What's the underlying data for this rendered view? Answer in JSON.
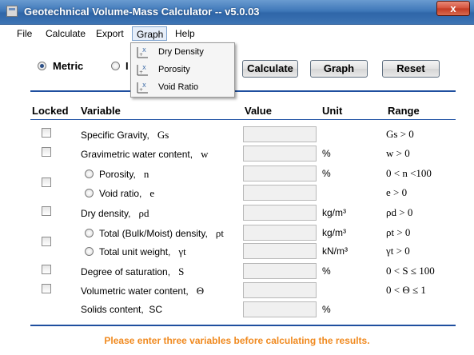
{
  "window": {
    "title": "Geotechnical Volume-Mass Calculator -- v5.0.03",
    "close_label": "x"
  },
  "menu": [
    "File",
    "Calculate",
    "Export",
    "Graph",
    "Help"
  ],
  "graph_menu": [
    {
      "label": "Dry Density",
      "icon": "xy-graph-icon"
    },
    {
      "label": "Porosity",
      "icon": "xy-graph-icon"
    },
    {
      "label": "Void Ratio",
      "icon": "xy-graph-icon"
    }
  ],
  "units": {
    "metric_label": "Metric",
    "imperial_label": "I",
    "selected": "Metric"
  },
  "buttons": {
    "calculate": "Calculate",
    "graph": "Graph",
    "reset": "Reset"
  },
  "headers": {
    "locked": "Locked",
    "variable": "Variable",
    "value": "Value",
    "unit": "Unit",
    "range": "Range"
  },
  "rows": [
    {
      "label": "Specific Gravity,",
      "symbol": "Gs",
      "unit": "",
      "range": "Gs > 0"
    },
    {
      "label": "Gravimetric water content,",
      "symbol": "w",
      "unit": "%",
      "range": "w > 0"
    },
    {
      "label": "Porosity,",
      "symbol": "n",
      "unit": "%",
      "range": "0 < n <100"
    },
    {
      "label": "Void ratio,",
      "symbol": "e",
      "unit": "",
      "range": "e > 0"
    },
    {
      "label": "Dry density,",
      "symbol": "ρd",
      "unit": "kg/m³",
      "range": "ρd > 0"
    },
    {
      "label": "Total (Bulk/Moist) density,",
      "symbol": "ρt",
      "unit": "kg/m³",
      "range": "ρt > 0"
    },
    {
      "label": "Total unit weight,",
      "symbol": "γt",
      "unit": "kN/m³",
      "range": "γt > 0"
    },
    {
      "label": "Degree of saturation,",
      "symbol": "S",
      "unit": "%",
      "range": "0 < S ≤ 100"
    },
    {
      "label": "Volumetric water content,",
      "symbol": "Θ",
      "unit": "",
      "range": "0 < Θ ≤ 1"
    },
    {
      "label": "Solids content,",
      "symbol": "SC",
      "unit": "%",
      "range": ""
    }
  ],
  "footer_message": "Please enter three variables before calculating the results."
}
